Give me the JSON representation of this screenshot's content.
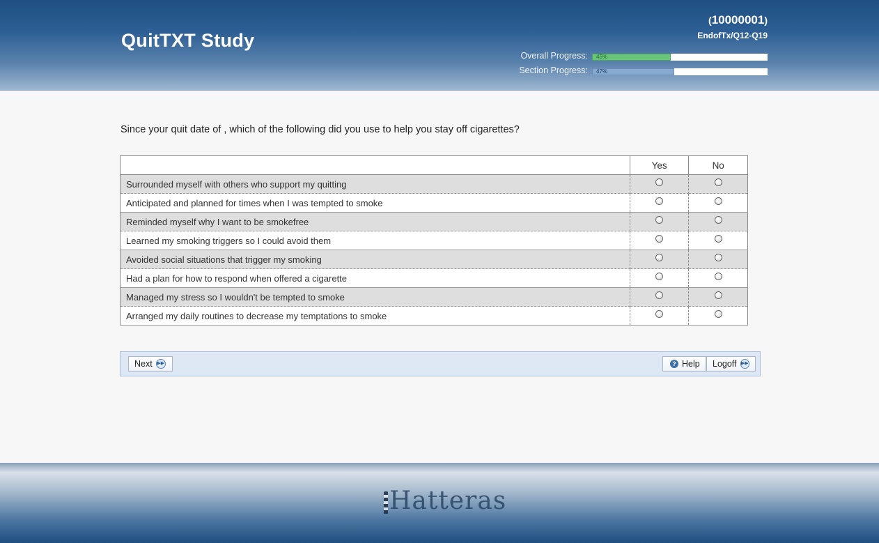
{
  "header": {
    "title": "QuitTXT Study",
    "participant_open": "(",
    "participant_id": "10000001",
    "participant_close": ")",
    "section_code": "EndofTx/Q12-Q19",
    "overall_label": "Overall Progress:",
    "overall_value": 45,
    "overall_pct_text": "45%",
    "section_label": "Section Progress:",
    "section_value": 47,
    "section_pct_text": "47%"
  },
  "question": {
    "text": "Since your quit date of , which of the following did you use to help you stay off cigarettes?",
    "columns": [
      "Yes",
      "No"
    ],
    "items": [
      "Surrounded myself with others who support my quitting",
      "Anticipated and planned for times when I was tempted to smoke",
      "Reminded myself why I want to be smokefree",
      "Learned my smoking triggers so I could avoid them",
      "Avoided social situations that trigger my smoking",
      "Had a plan for how to respond when offered a cigarette",
      "Managed my stress so I wouldn't be tempted to smoke",
      "Arranged my daily routines to decrease my temptations to smoke"
    ]
  },
  "nav": {
    "next_label": "Next",
    "help_label": "Help",
    "logoff_label": "Logoff"
  },
  "footer": {
    "logo_text": "Hatteras"
  },
  "colors": {
    "header_top": "#1f4f82",
    "overall_fill": "#6ac47a",
    "section_fill": "#87a9cf",
    "navbar_bg": "#dde8f4"
  },
  "icons": {
    "next": "arrow-right-circle-icon",
    "help": "help-circle-icon",
    "logoff": "arrow-right-circle-icon",
    "logo": "lighthouse-icon"
  }
}
